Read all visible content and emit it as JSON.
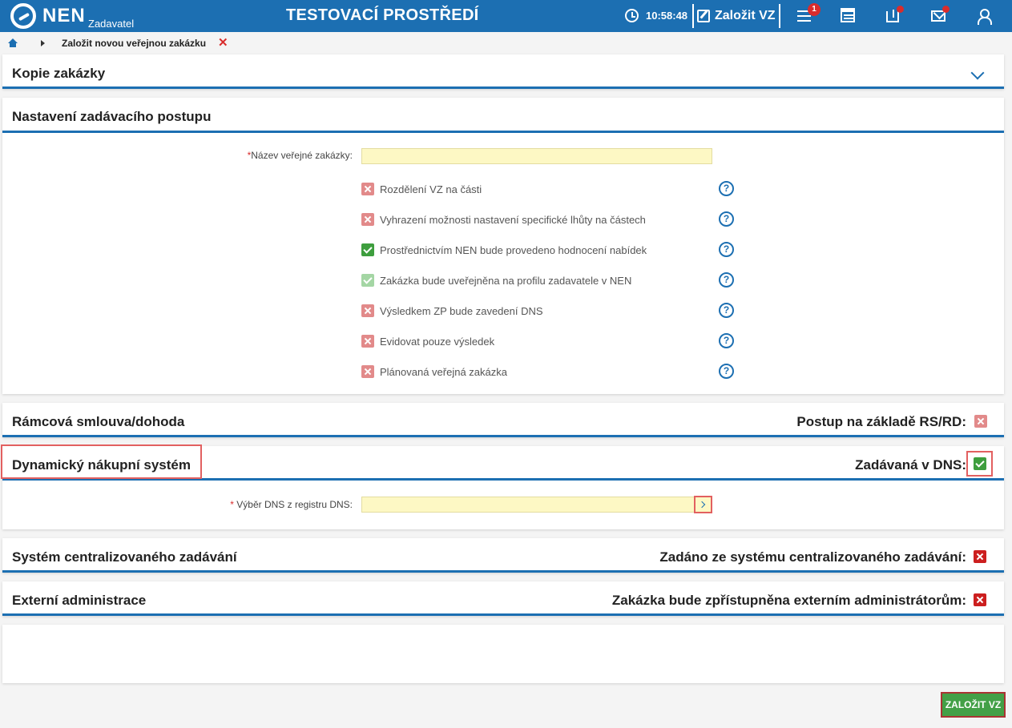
{
  "topbar": {
    "logo_text": "NEN",
    "logo_sub": "Zadavatel",
    "env_title": "TESTOVACÍ PROSTŘEDÍ",
    "clock": "10:58:48",
    "create_label": "Založit VZ",
    "menu_badge": "1",
    "accent_color": "#1c6fb2"
  },
  "breadcrumb": {
    "current": "Založit novou veřejnou zakázku",
    "close_glyph": "✕"
  },
  "kopie": {
    "title": "Kopie zakázky"
  },
  "nastaveni": {
    "title": "Nastavení zadávacího postupu",
    "name_label": "Název veřejné zakázky:",
    "name_value": "",
    "options": [
      {
        "label": "Rozdělení VZ na části",
        "state": "unchecked"
      },
      {
        "label": "Vyhrazení možnosti nastavení specifické lhůty na částech",
        "state": "unchecked"
      },
      {
        "label": "Prostřednictvím NEN bude provedeno hodnocení nabídek",
        "state": "checked"
      },
      {
        "label": "Zakázka bude uveřejněna na profilu zadavatele v NEN",
        "state": "checked-disabled"
      },
      {
        "label": "Výsledkem ZP bude zavedení DNS",
        "state": "unchecked"
      },
      {
        "label": "Evidovat pouze výsledek",
        "state": "unchecked"
      },
      {
        "label": "Plánovaná veřejná zakázka",
        "state": "unchecked"
      }
    ],
    "help_glyph": "?"
  },
  "ramcova": {
    "title": "Rámcová smlouva/dohoda",
    "right_label": "Postup na základě RS/RD:"
  },
  "dns": {
    "title": "Dynamický nákupní systém",
    "right_label": "Zadávaná v DNS:",
    "field_label": "Výběr DNS z registru DNS:",
    "field_value": ""
  },
  "centralizovane": {
    "title": "Systém centralizovaného zadávání",
    "right_label": "Zadáno ze systému centralizovaného zadávání:"
  },
  "externi": {
    "title": "Externí administrace",
    "right_label": "Zakázka bude zpřístupněna externím administrátorům:"
  },
  "submit_label": "ZALOŽIT VZ",
  "required_mark": "*"
}
